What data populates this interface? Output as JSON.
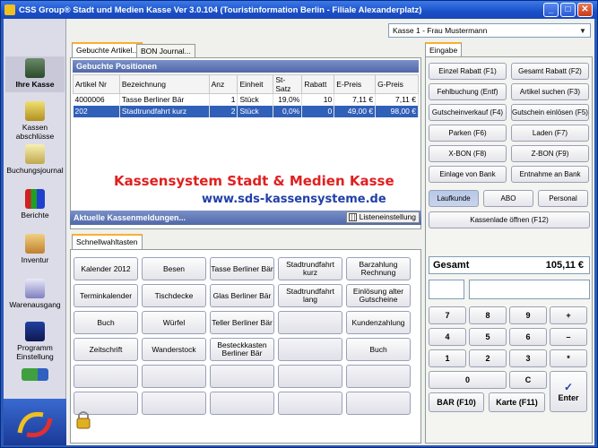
{
  "window": {
    "title": "CSS Group® Stadt und Medien Kasse Ver 3.0.104 (Touristinformation Berlin - Filiale Alexanderplatz)",
    "min": "_",
    "max": "□",
    "close": "✕"
  },
  "sidebar": {
    "items": [
      {
        "label": "Ihre Kasse",
        "icon": "calculator-icon"
      },
      {
        "label": "Kassen abschlüsse",
        "icon": "cash-register-icon"
      },
      {
        "label": "Buchungsjournal",
        "icon": "journal-icon"
      },
      {
        "label": "Berichte",
        "icon": "bar-chart-icon"
      },
      {
        "label": "Inventur",
        "icon": "inventory-icon"
      },
      {
        "label": "Warenausgang",
        "icon": "goods-out-icon"
      },
      {
        "label": "Programm Einstellung",
        "icon": "settings-computer-icon"
      }
    ]
  },
  "topbar": {
    "kasse_select": "Kasse 1 - Frau Mustermann"
  },
  "tabs": {
    "booked": "Gebuchte Artikel...",
    "journal": "BON Journal..."
  },
  "positions": {
    "header": "Gebuchte Positionen",
    "columns": [
      "Artikel Nr",
      "Bezeichnung",
      "Anz",
      "Einheit",
      "St-Satz",
      "Rabatt",
      "E-Preis",
      "G-Preis"
    ],
    "rows": [
      [
        "4000006",
        "Tasse Berliner Bär",
        "1",
        "Stück",
        "19,0%",
        "10",
        "7,11 €",
        "7,11 €"
      ],
      [
        "202",
        "Stadtrundfahrt kurz",
        "2",
        "Stück",
        "0,0%",
        "0",
        "49,00 €",
        "98,00 €"
      ]
    ]
  },
  "promo": {
    "title": "Kassensystem Stadt & Medien Kasse",
    "url": "www.sds-kassensysteme.de"
  },
  "messages": {
    "header": "Aktuelle Kassenmeldungen...",
    "list_button": "Listeneinstellung"
  },
  "quick": {
    "tab": "Schnellwahltasten",
    "buttons": [
      "Kalender 2012",
      "Besen",
      "Tasse Berliner Bär",
      "Stadtrundfahrt kurz",
      "Barzahlung Rechnung",
      "Terminkalender",
      "Tischdecke",
      "Glas Berliner Bär",
      "Stadtrundfahrt lang",
      "Einlösung alter Gutscheine",
      "Buch",
      "Würfel",
      "Teller Berliner Bär",
      "",
      "Kundenzahlung",
      "Zeitschrift",
      "Wanderstock",
      "Besteckkasten Berliner Bär",
      "",
      "Buch",
      "",
      "",
      "",
      "",
      "",
      "",
      "",
      "",
      "",
      ""
    ]
  },
  "eingabe": {
    "tab": "Eingabe",
    "fbuttons": [
      "Einzel Rabatt (F1)",
      "Gesamt Rabatt (F2)",
      "Fehlbuchung (Entf)",
      "Artikel suchen (F3)",
      "Gutscheinverkauf (F4)",
      "Gutschein einlösen (F5)",
      "Parken (F6)",
      "Laden (F7)",
      "X-BON (F8)",
      "Z-BON (F9)",
      "Einlage von Bank",
      "Entnahme an Bank"
    ],
    "customer": [
      "Laufkunde",
      "ABO",
      "Personal"
    ],
    "drawer": "Kassenlade öffnen (F12)",
    "total_label": "Gesamt",
    "total_value": "105,11 €",
    "keys": [
      "7",
      "8",
      "9",
      "+",
      "4",
      "5",
      "6",
      "–",
      "1",
      "2",
      "3",
      "*",
      "0",
      "C",
      "✓",
      "Enter"
    ],
    "bar": "BAR (F10)",
    "karte": "Karte (F11)"
  }
}
